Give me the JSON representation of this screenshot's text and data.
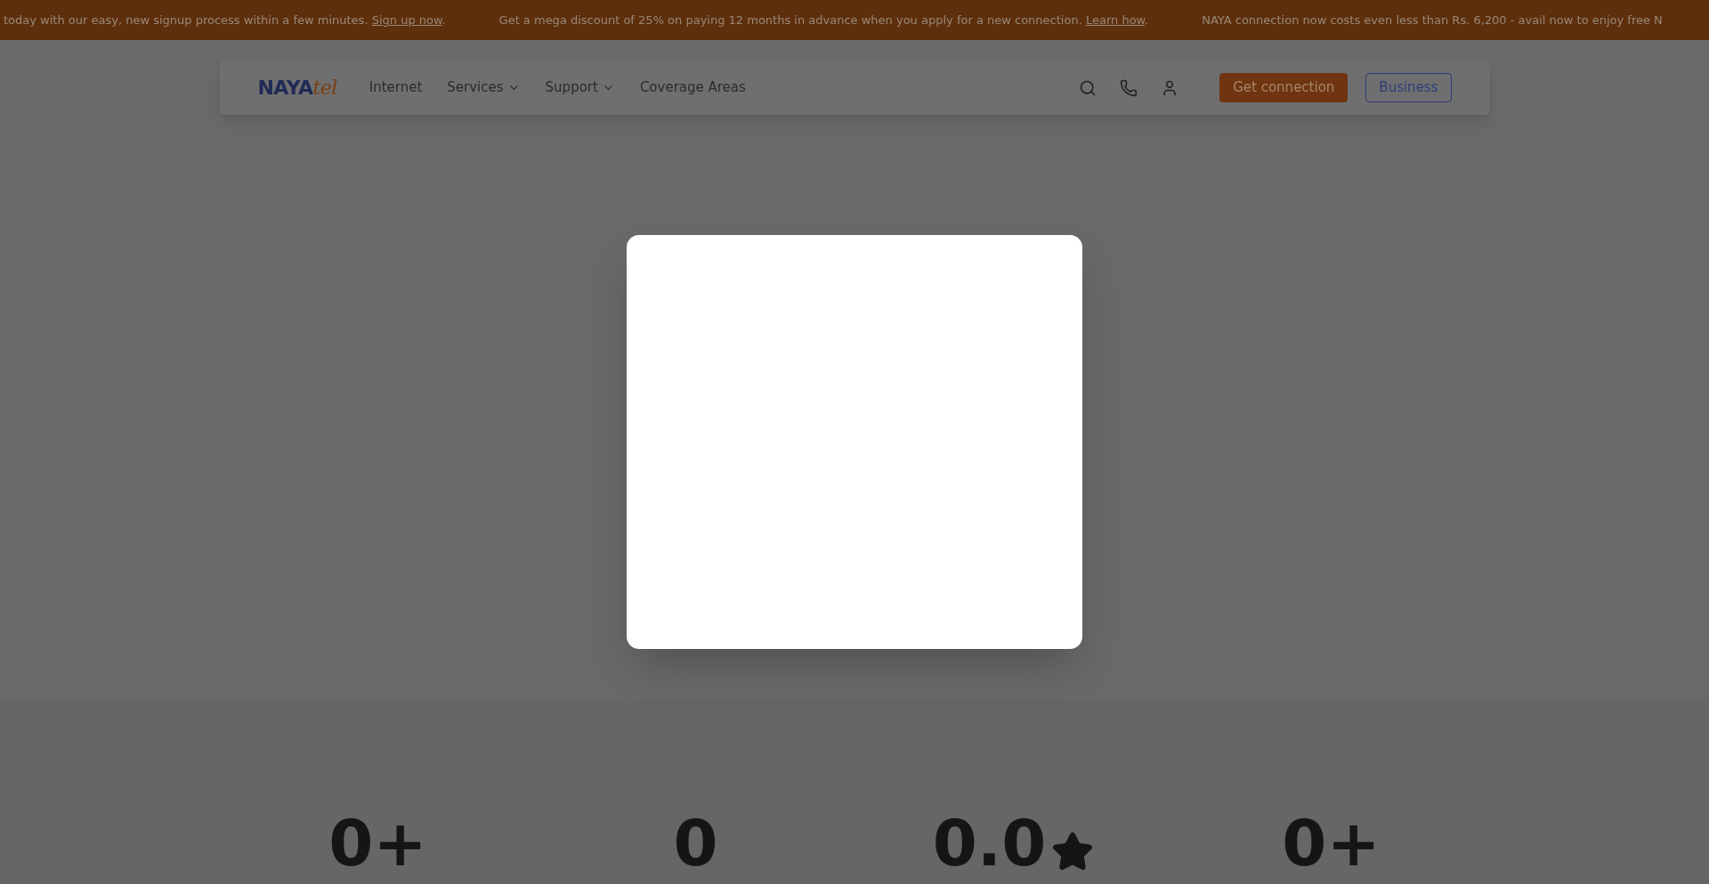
{
  "announcement_bar": [
    {
      "text": "today with our easy, new signup process within a few minutes.",
      "link": "Sign up now",
      "trail": "."
    },
    {
      "text": "Get a mega discount of 25% on paying 12 months in advance when you apply for a new connection.",
      "link": "Learn how",
      "trail": "."
    },
    {
      "text": "NAYA connection now costs even less than Rs. 6,200 - avail now to enjoy free N"
    }
  ],
  "nav": {
    "logo": {
      "main": "NAYA",
      "accent": "tel"
    },
    "links": [
      {
        "label": "Internet",
        "dropdown": false
      },
      {
        "label": "Services",
        "dropdown": true
      },
      {
        "label": "Support",
        "dropdown": true
      },
      {
        "label": "Coverage Areas",
        "dropdown": false
      }
    ],
    "primary_button": "Get connection",
    "secondary_button": "Business"
  },
  "stats": [
    {
      "value": "0+",
      "star": false
    },
    {
      "value": "0",
      "star": false
    },
    {
      "value": "0.0",
      "star": true
    },
    {
      "value": "0+",
      "star": false
    }
  ]
}
